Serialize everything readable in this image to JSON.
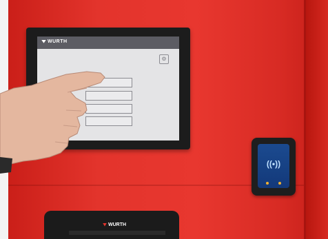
{
  "screen": {
    "logo": "WURTH",
    "buttons": [
      "",
      "",
      "",
      ""
    ]
  },
  "dispenser": {
    "logo": "WURTH"
  },
  "reader": {
    "symbol": "((•))"
  },
  "colors": {
    "cabinet_red": "#e3342c",
    "bezel": "#1c1c1c",
    "screen_bg": "#e4e4e6",
    "screen_header": "#5c5c63",
    "reader_pad": "#1b4a8f",
    "reader_led": "#f2b233"
  }
}
